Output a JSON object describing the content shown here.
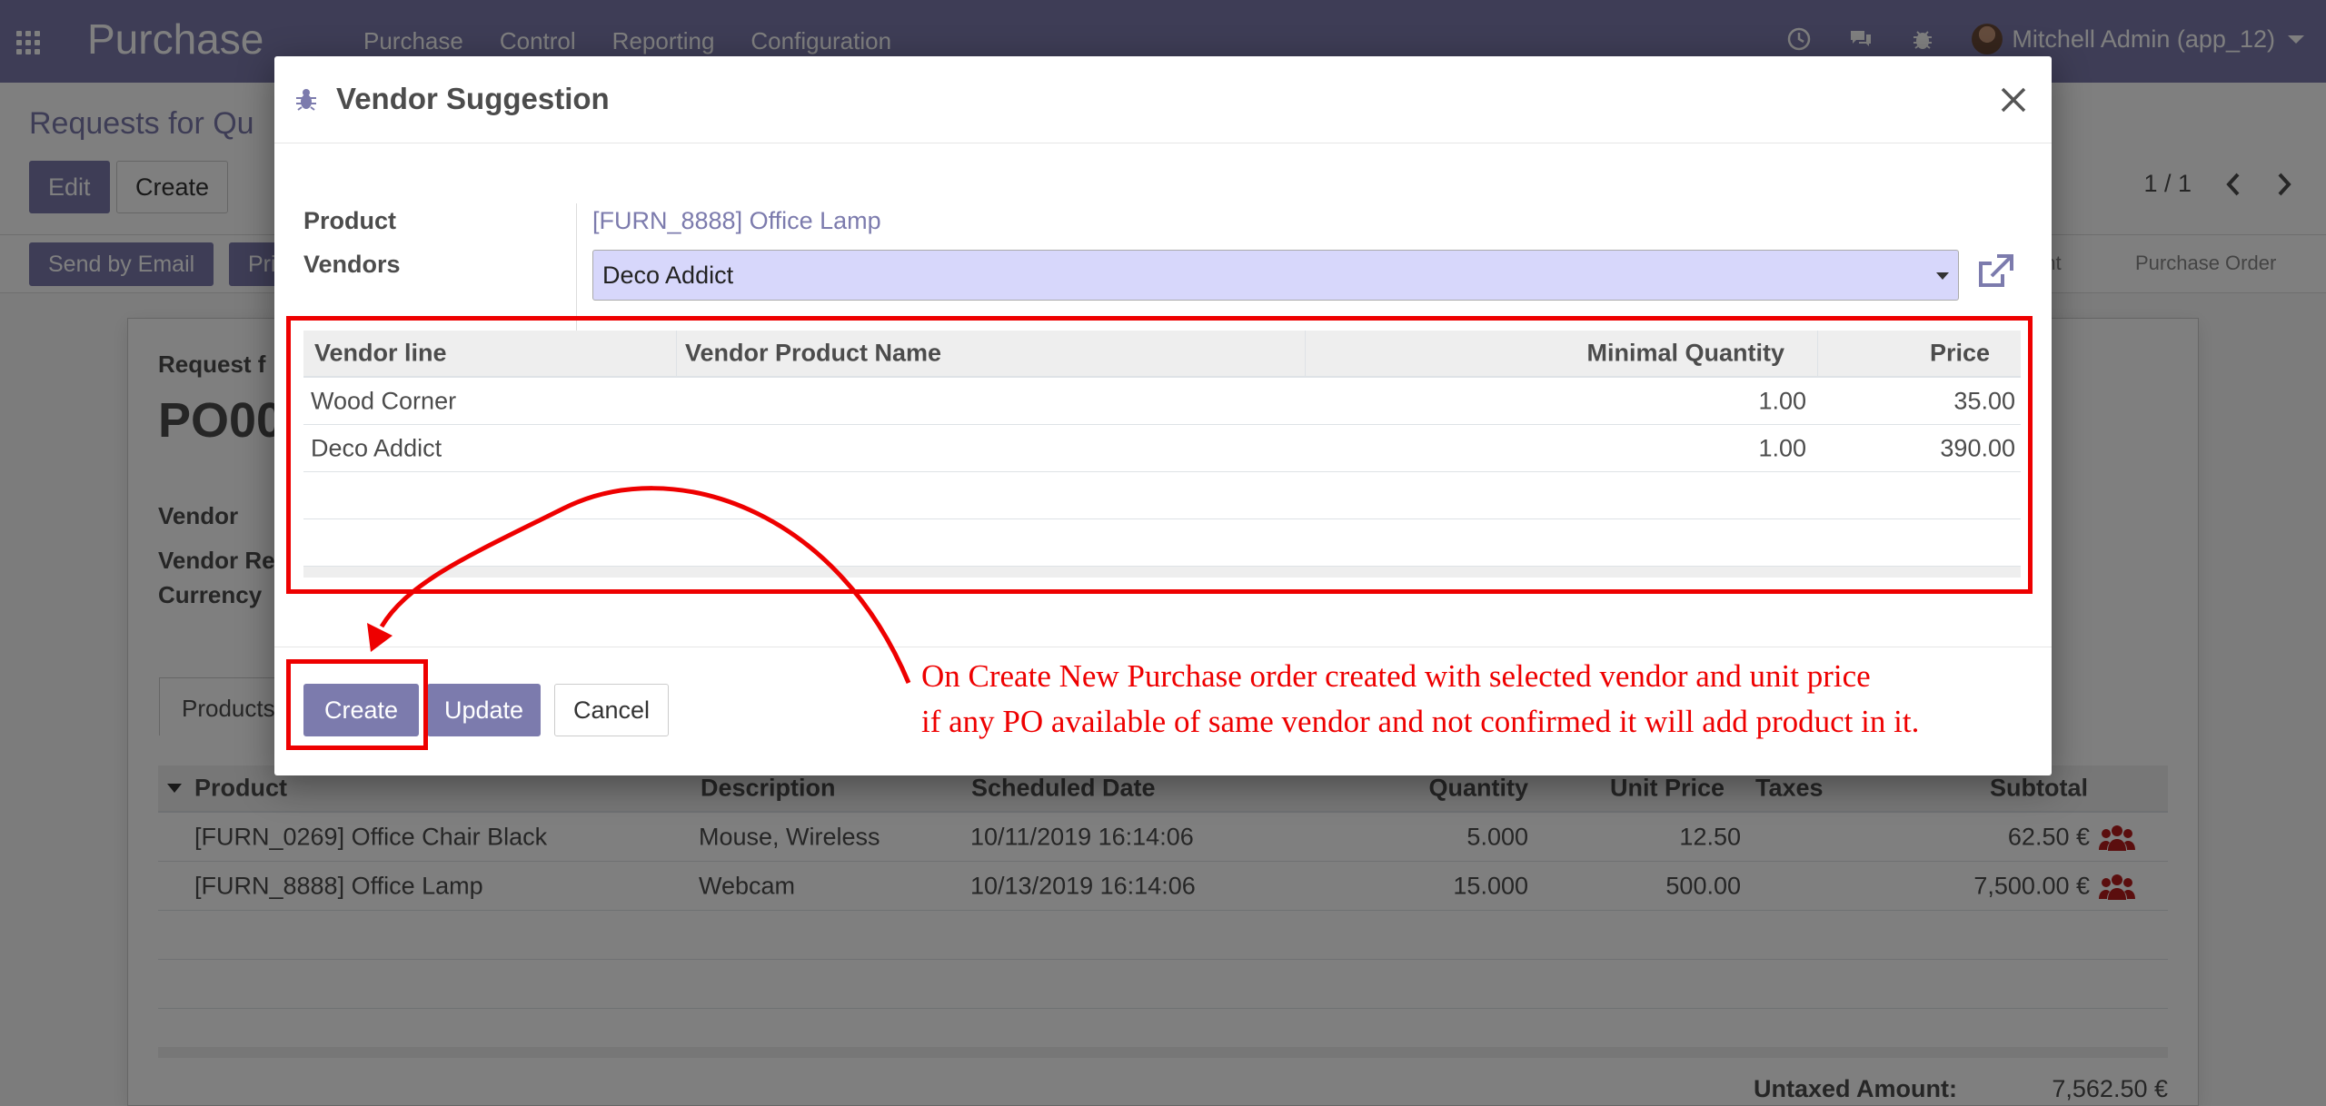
{
  "navbar": {
    "app_title": "Purchase",
    "menu": [
      "Purchase",
      "Control",
      "Reporting",
      "Configuration"
    ],
    "user": "Mitchell Admin (app_12)"
  },
  "control_panel": {
    "title": "Requests for Qu",
    "edit_label": "Edit",
    "create_label": "Create",
    "pager": "1 / 1",
    "send_by_email": "Send by Email",
    "print_partial": "Pri",
    "stage_partial": "ent",
    "stage_purchase_order": "Purchase Order"
  },
  "form": {
    "request_label_partial": "Request f",
    "po_name_partial": "PO00",
    "vendor_label": "Vendor",
    "vendor_ref_partial": "Vendor Re",
    "currency_label": "Currency",
    "tab_products_partial": "Products",
    "columns": [
      "Product",
      "Description",
      "Scheduled Date",
      "Quantity",
      "Unit Price",
      "Taxes",
      "Subtotal"
    ],
    "lines": [
      {
        "product": "[FURN_0269] Office Chair Black",
        "description": "Mouse, Wireless",
        "date": "10/11/2019 16:14:06",
        "quantity": "5.000",
        "unit_price": "12.50",
        "taxes": "",
        "subtotal": "62.50 €"
      },
      {
        "product": "[FURN_8888] Office Lamp",
        "description": "Webcam",
        "date": "10/13/2019 16:14:06",
        "quantity": "15.000",
        "unit_price": "500.00",
        "taxes": "",
        "subtotal": "7,500.00 €"
      }
    ],
    "untaxed_label": "Untaxed Amount:",
    "untaxed_value": "7,562.50 €"
  },
  "modal": {
    "title": "Vendor Suggestion",
    "product_label": "Product",
    "product_value": "[FURN_8888] Office Lamp",
    "vendors_label": "Vendors",
    "vendors_value": "Deco Addict",
    "table_columns": [
      "Vendor line",
      "Vendor Product Name",
      "Minimal Quantity",
      "Price"
    ],
    "vendor_lines": [
      {
        "vendor": "Wood Corner",
        "product_name": "",
        "min_qty": "1.00",
        "price": "35.00"
      },
      {
        "vendor": "Deco Addict",
        "product_name": "",
        "min_qty": "1.00",
        "price": "390.00"
      }
    ],
    "create_label": "Create",
    "update_label": "Update",
    "cancel_label": "Cancel"
  },
  "annotation": {
    "line1": "On Create New Purchase order created with selected vendor and unit price",
    "line2": "if any PO available of same vendor and not confirmed it will add product in it.",
    "color": "#ee0000"
  },
  "colors": {
    "brand": "#7c7bad",
    "select_bg": "#d7d7fb",
    "icon_red": "#b71c1c"
  }
}
